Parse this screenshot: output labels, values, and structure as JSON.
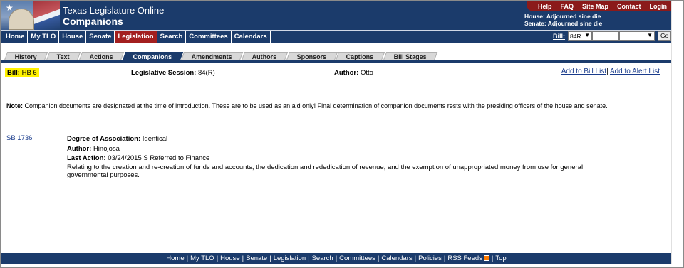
{
  "header": {
    "site_title": "Texas Legislature Online",
    "page_title": "Companions",
    "util_links": [
      "Help",
      "FAQ",
      "Site Map",
      "Contact",
      "Login"
    ],
    "house_status": "House: Adjourned sine die",
    "senate_status": "Senate: Adjourned sine die",
    "colors": {
      "primary": "#1b3b6b",
      "accent": "#a31f1f"
    }
  },
  "nav": {
    "items": [
      {
        "label": "Home",
        "active": false
      },
      {
        "label": "My TLO",
        "active": false
      },
      {
        "label": "House",
        "active": false
      },
      {
        "label": "Senate",
        "active": false
      },
      {
        "label": "Legislation",
        "active": true
      },
      {
        "label": "Search",
        "active": false
      },
      {
        "label": "Committees",
        "active": false
      },
      {
        "label": "Calendars",
        "active": false
      }
    ],
    "bill_label": "Bill:",
    "session_value": "84R",
    "bill_input_value": "",
    "chamber_value": "",
    "go_label": "Go"
  },
  "tabs": [
    {
      "label": "History",
      "active": false
    },
    {
      "label": "Text",
      "active": false
    },
    {
      "label": "Actions",
      "active": false
    },
    {
      "label": "Companions",
      "active": true
    },
    {
      "label": "Amendments",
      "active": false
    },
    {
      "label": "Authors",
      "active": false
    },
    {
      "label": "Sponsors",
      "active": false
    },
    {
      "label": "Captions",
      "active": false
    },
    {
      "label": "Bill Stages",
      "active": false
    }
  ],
  "bill": {
    "bill_label": "Bill:",
    "bill_number": "HB 6",
    "session_label": "Legislative Session:",
    "session_value": "84(R)",
    "author_label": "Author:",
    "author_value": "Otto",
    "add_bill_list": "Add to Bill List",
    "add_alert_list": "Add to Alert List"
  },
  "note": {
    "label": "Note:",
    "text": "Companion documents are designated at the time of introduction. These are to be used as an aid only! Final determination of companion documents rests with the presiding officers of the house and senate."
  },
  "companion": {
    "bill_link": "SB 1736",
    "degree_label": "Degree of Association:",
    "degree_value": "Identical",
    "author_label": "Author:",
    "author_value": "Hinojosa",
    "last_action_label": "Last Action:",
    "last_action_value": "03/24/2015 S Referred to Finance",
    "description": "Relating to the creation and re-creation of funds and accounts, the dedication and rededication of revenue, and the exemption of unappropriated money from use for general governmental purposes."
  },
  "footer": {
    "links": [
      "Home",
      "My TLO",
      "House",
      "Senate",
      "Legislation",
      "Search",
      "Committees",
      "Calendars",
      "Policies",
      "RSS Feeds",
      "Top"
    ]
  }
}
